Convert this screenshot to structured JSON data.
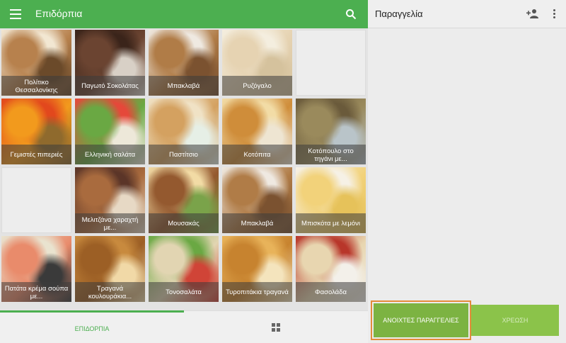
{
  "topbar": {
    "title": "Επιδόρπια",
    "menu_icon": "menu-icon",
    "search_icon": "search-icon"
  },
  "tiles": [
    {
      "name": "Πολίτικο Θεσσαλονίκης",
      "image": "cake-slice",
      "colors": [
        "#f2e7d2",
        "#b7814d",
        "#6b4a2a"
      ]
    },
    {
      "name": "Παγωτό Σοκολάτας",
      "image": "chocolate-ice-cream",
      "colors": [
        "#3a241a",
        "#6b4431",
        "#d8d0c6"
      ]
    },
    {
      "name": "Μπακλαβά",
      "image": "baklava",
      "colors": [
        "#efe9e1",
        "#b07c47",
        "#7b5230"
      ]
    },
    {
      "name": "Ρυζόγαλο",
      "image": "rice-pudding",
      "colors": [
        "#f4eedf",
        "#e6d3b2",
        "#d5c29d"
      ]
    },
    {
      "name": "",
      "image": "empty"
    },
    {
      "name": "Γεμιστές πιπεριές",
      "image": "stuffed-peppers",
      "colors": [
        "#e2481d",
        "#f29a1d",
        "#8f6a2d"
      ]
    },
    {
      "name": "Ελληνική σαλάτα",
      "image": "greek-salad",
      "colors": [
        "#e5483a",
        "#6aa843",
        "#ede8d9"
      ]
    },
    {
      "name": "Παστίτσιο",
      "image": "pastitsio",
      "colors": [
        "#f0e2c5",
        "#d4a160",
        "#e6efe6"
      ]
    },
    {
      "name": "Κοτόπιτα",
      "image": "chicken-pie",
      "colors": [
        "#f2dca6",
        "#cf8d3a",
        "#eee5d2"
      ]
    },
    {
      "name": "Κοτόπουλο στο τηγάνι με...",
      "image": "chicken-pan",
      "colors": [
        "#6a5a3b",
        "#9a8a5c",
        "#b9c4c9"
      ]
    },
    {
      "name": "",
      "image": "empty"
    },
    {
      "name": "Μελιτζάνα χαραχτή με...",
      "image": "eggplant",
      "colors": [
        "#5b3528",
        "#a96b3e",
        "#e7d9c5"
      ]
    },
    {
      "name": "Μουσακάς",
      "image": "moussaka",
      "colors": [
        "#f2dba5",
        "#94592f",
        "#7aa34a"
      ]
    },
    {
      "name": "Μπακλαβά",
      "image": "baklava",
      "colors": [
        "#efe9e1",
        "#b07c47",
        "#7b5230"
      ]
    },
    {
      "name": "Μπισκότα με λεμόνι",
      "image": "lemon-cookies",
      "colors": [
        "#f6f1e6",
        "#f2d27a",
        "#e6c25a"
      ]
    },
    {
      "name": "Πατάτα κρέμα σούπα με...",
      "image": "potato-soup",
      "colors": [
        "#e9e3cf",
        "#e98b6b",
        "#3a3a3a"
      ]
    },
    {
      "name": "Τραγανά κουλουράκια...",
      "image": "rings",
      "colors": [
        "#c88a3e",
        "#9c5f25",
        "#f1d9a7"
      ]
    },
    {
      "name": "Τονοσαλάτα",
      "image": "tuna-salad",
      "colors": [
        "#6aa843",
        "#e2d5b2",
        "#d04437"
      ]
    },
    {
      "name": "Τυροπιτάκια τραγανά",
      "image": "cheese-pies",
      "colors": [
        "#e8b35a",
        "#c7832f",
        "#f4e4bd"
      ]
    },
    {
      "name": "Φασολάδα",
      "image": "bean-soup",
      "colors": [
        "#b8362a",
        "#e8d6b0",
        "#f3f0ea"
      ]
    }
  ],
  "bottom": {
    "tab_label": "ΕΠΙΔΟΡΠΙΑ",
    "grid_icon": "grid-icon"
  },
  "order": {
    "title": "Παραγγελία",
    "add_icon": "add-person-icon",
    "more_icon": "more-vert-icon"
  },
  "buttons": {
    "open_orders": "ΑΝΟΙΧΤΕΣ ΠΑΡΑΓΓΕΛΙΕΣ",
    "debit": "ΧΡΕΩΣΗ"
  },
  "colors": {
    "primary": "#4caf50",
    "button_green": "#7cb342",
    "highlight": "#e38b3a"
  }
}
